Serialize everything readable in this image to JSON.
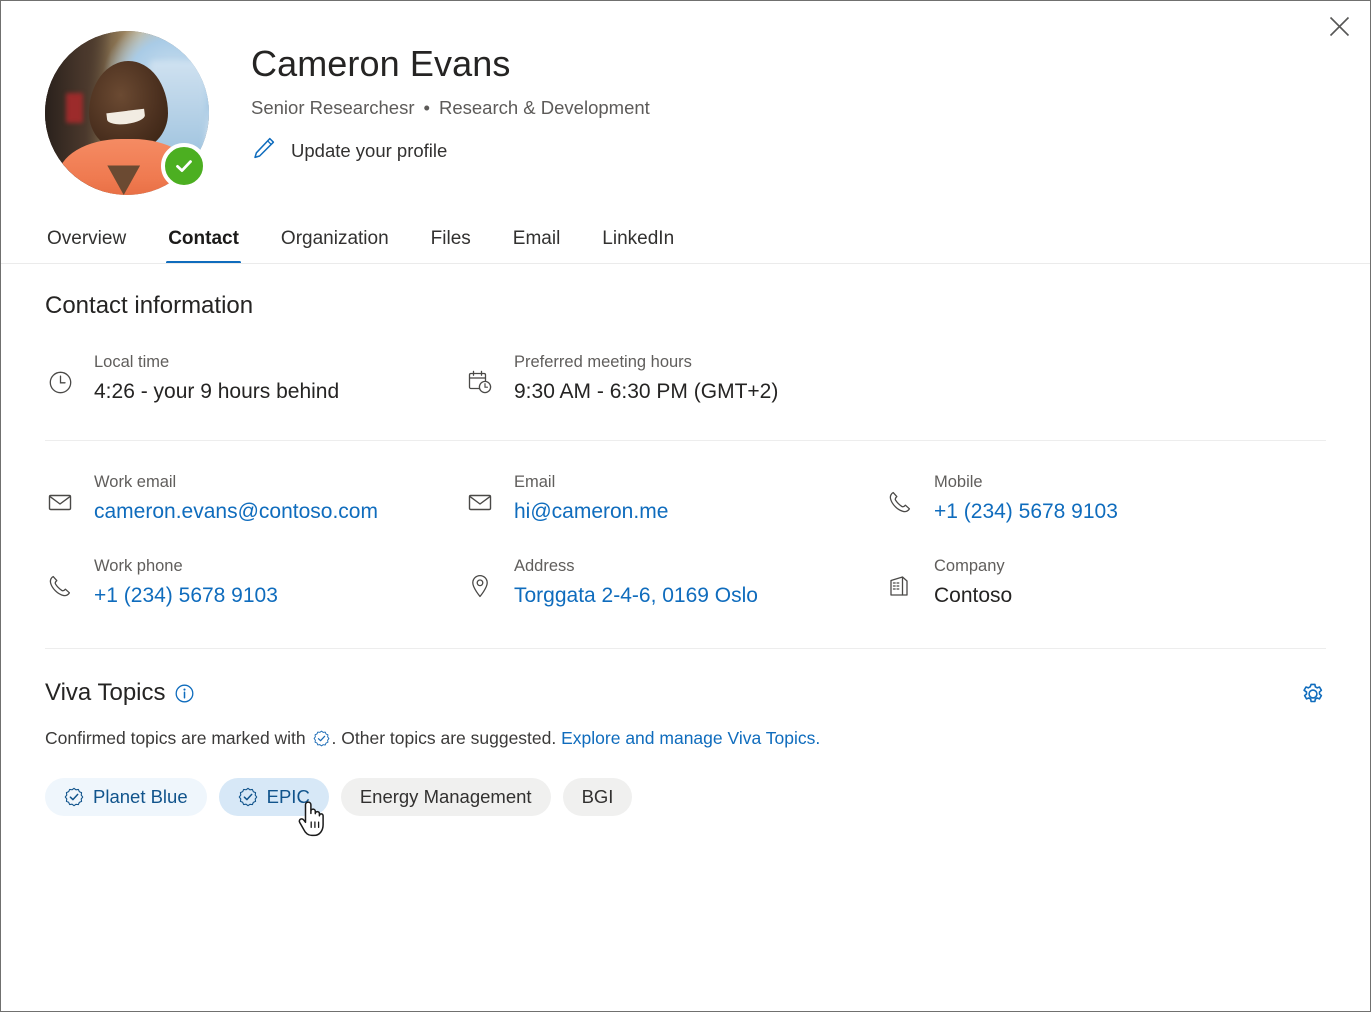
{
  "window": {
    "close_label": "Close"
  },
  "profile": {
    "name": "Cameron Evans",
    "title": "Senior Researchesr",
    "separator": "•",
    "department": "Research & Development",
    "update_link": "Update your profile",
    "presence": "available"
  },
  "tabs": [
    {
      "label": "Overview",
      "active": false
    },
    {
      "label": "Contact",
      "active": true
    },
    {
      "label": "Organization",
      "active": false
    },
    {
      "label": "Files",
      "active": false
    },
    {
      "label": "Email",
      "active": false
    },
    {
      "label": "LinkedIn",
      "active": false
    }
  ],
  "contact": {
    "heading": "Contact information",
    "local_time": {
      "label": "Local time",
      "value": "4:26 - your 9 hours behind",
      "icon": "clock-icon"
    },
    "meeting_hours": {
      "label": "Preferred meeting hours",
      "value": "9:30 AM - 6:30 PM (GMT+2)",
      "icon": "calendar-clock-icon"
    },
    "work_email": {
      "label": "Work email",
      "value": "cameron.evans@contoso.com",
      "icon": "mail-icon",
      "is_link": true
    },
    "email": {
      "label": "Email",
      "value": "hi@cameron.me",
      "icon": "mail-icon",
      "is_link": true
    },
    "mobile": {
      "label": "Mobile",
      "value": "+1 (234) 5678 9103",
      "icon": "phone-icon",
      "is_link": true
    },
    "work_phone": {
      "label": "Work phone",
      "value": "+1 (234) 5678 9103",
      "icon": "phone-icon",
      "is_link": true
    },
    "address": {
      "label": "Address",
      "value": "Torggata 2-4-6, 0169 Oslo",
      "icon": "location-pin-icon",
      "is_link": true
    },
    "company": {
      "label": "Company",
      "value": "Contoso",
      "icon": "building-icon",
      "is_link": false
    }
  },
  "viva_topics": {
    "heading": "Viva Topics",
    "info_icon": "info-icon",
    "settings_icon": "gear-icon",
    "description_before": "Confirmed topics are marked with",
    "description_after": ". Other topics are suggested.",
    "explore_link": "Explore and manage Viva Topics.",
    "chips": [
      {
        "label": "Planet Blue",
        "confirmed": true,
        "hover": false
      },
      {
        "label": "EPIC",
        "confirmed": true,
        "hover": true
      },
      {
        "label": "Energy Management",
        "confirmed": false,
        "hover": false
      },
      {
        "label": "BGI",
        "confirmed": false,
        "hover": false
      }
    ]
  },
  "colors": {
    "accent": "#0f6cbd",
    "link": "#0f6cbd",
    "text_primary": "#252423",
    "text_secondary": "#605e5c",
    "presence_green": "#4caf21",
    "chip_confirmed_bg": "#eff6fc",
    "chip_confirmed_hover_bg": "#d7e8f7",
    "chip_suggested_bg": "#f0f0ef",
    "divider": "#ededed"
  }
}
